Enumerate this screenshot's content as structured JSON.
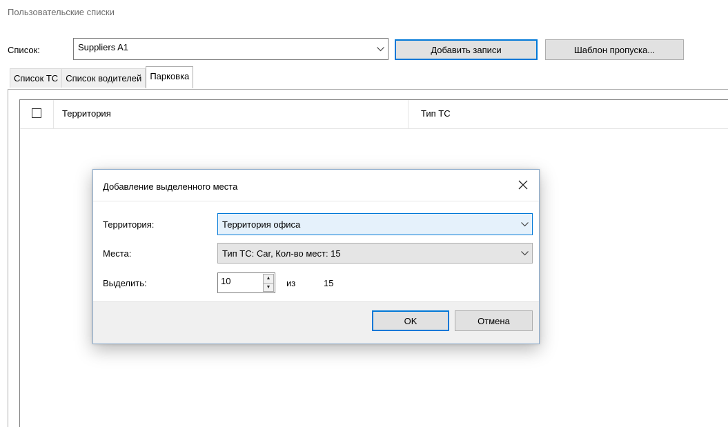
{
  "page": {
    "title": "Пользовательские списки"
  },
  "list_selector": {
    "label": "Список:",
    "value": "Suppliers A1"
  },
  "toolbar": {
    "add_records_label": "Добавить записи",
    "pass_template_label": "Шаблон пропуска..."
  },
  "tabs": [
    {
      "label": "Список ТС",
      "active": false
    },
    {
      "label": "Список водителей",
      "active": false
    },
    {
      "label": "Парковка",
      "active": true
    }
  ],
  "grid": {
    "columns": [
      {
        "label": "Территория"
      },
      {
        "label": "Тип ТС"
      }
    ],
    "select_all_checked": false
  },
  "dialog": {
    "title": "Добавление выделенного места",
    "territory": {
      "label": "Территория:",
      "value": "Территория офиса"
    },
    "places": {
      "label": "Места:",
      "value": "Тип ТС: Car, Кол-во мест: 15"
    },
    "allocate": {
      "label": "Выделить:",
      "value": "10",
      "of_label": "из",
      "total": "15"
    },
    "ok_label": "OK",
    "cancel_label": "Отмена"
  },
  "colors": {
    "accent": "#0078d7",
    "button_bg": "#e1e1e1",
    "dialog_footer_bg": "#f0f0f0",
    "selected_combo_bg": "#e5f1fb"
  }
}
